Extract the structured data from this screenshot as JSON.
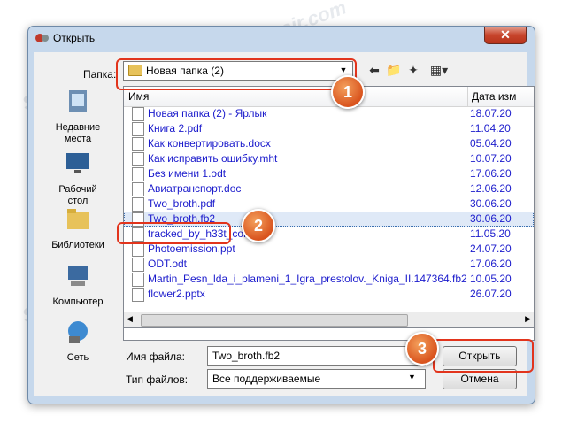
{
  "window": {
    "title": "Открыть",
    "close_glyph": "✕"
  },
  "toolbar": {
    "folder_label": "Папка:",
    "folder_value": "Новая папка (2)"
  },
  "places": [
    {
      "label": "Недавние места"
    },
    {
      "label": "Рабочий стол"
    },
    {
      "label": "Библиотеки"
    },
    {
      "label": "Компьютер"
    },
    {
      "label": "Сеть"
    }
  ],
  "columns": {
    "name": "Имя",
    "date": "Дата изм"
  },
  "files": [
    {
      "name": "Новая папка (2) - Ярлык",
      "date": "18.07.20",
      "icon": "shortcut-icon"
    },
    {
      "name": "Книга 2.pdf",
      "date": "11.04.20",
      "icon": "pdf-icon"
    },
    {
      "name": "Как конвертировать.docx",
      "date": "05.04.20",
      "icon": "word-icon"
    },
    {
      "name": "Как исправить ошибку.mht",
      "date": "10.07.20",
      "icon": "web-icon"
    },
    {
      "name": "Без имени 1.odt",
      "date": "17.06.20",
      "icon": "odt-icon"
    },
    {
      "name": "Авиатранспорт.doc",
      "date": "12.06.20",
      "icon": "word-icon"
    },
    {
      "name": "Two_broth.pdf",
      "date": "30.06.20",
      "icon": "pdf-icon"
    },
    {
      "name": "Two_broth.fb2",
      "date": "30.06.20",
      "icon": "file-icon"
    },
    {
      "name": "tracked_by_h33t_com.txt",
      "date": "11.05.20",
      "icon": "text-icon"
    },
    {
      "name": "Photoemission.ppt",
      "date": "24.07.20",
      "icon": "file-icon"
    },
    {
      "name": "ODT.odt",
      "date": "17.06.20",
      "icon": "odt-icon"
    },
    {
      "name": "Martin_Pesn_lda_i_plameni_1_Igra_prestolov._Kniga_II.147364.fb2",
      "date": "10.05.20",
      "icon": "file-icon"
    },
    {
      "name": "flower2.pptx",
      "date": "26.07.20",
      "icon": "pptx-icon"
    }
  ],
  "selected_index": 7,
  "filename": {
    "label": "Имя файла:",
    "value": "Two_broth.fb2"
  },
  "filetype": {
    "label": "Тип файлов:",
    "value": "Все поддерживаемые"
  },
  "buttons": {
    "open": "Открыть",
    "cancel": "Отмена"
  },
  "annotations": [
    "1",
    "2",
    "3"
  ],
  "watermark": "Soringpcrepair.com"
}
